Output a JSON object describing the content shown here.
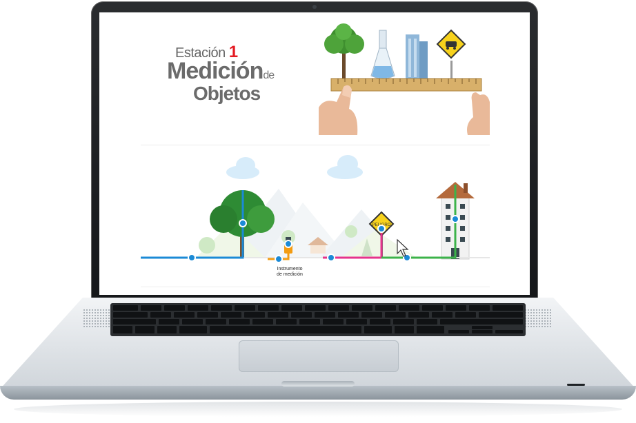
{
  "page": {
    "title_station_word": "Estación",
    "title_station_number": "1",
    "title_line1": "Medición",
    "title_de": "de",
    "title_line2": "Objetos"
  },
  "scene": {
    "instrument_label_line1": "Instrumento",
    "instrument_label_line2": "de medición",
    "sign_text": "PELIGRO"
  },
  "icons": {
    "cursor": "arrow-cursor-icon",
    "sign": "car-warning-sign-icon"
  },
  "colors": {
    "accent_red": "#e41c24",
    "line_blue": "#1b8ad6",
    "line_orange": "#f39c12",
    "line_pink": "#e6338c",
    "line_green": "#3cb34a",
    "tree_green": "#2e8b34"
  }
}
